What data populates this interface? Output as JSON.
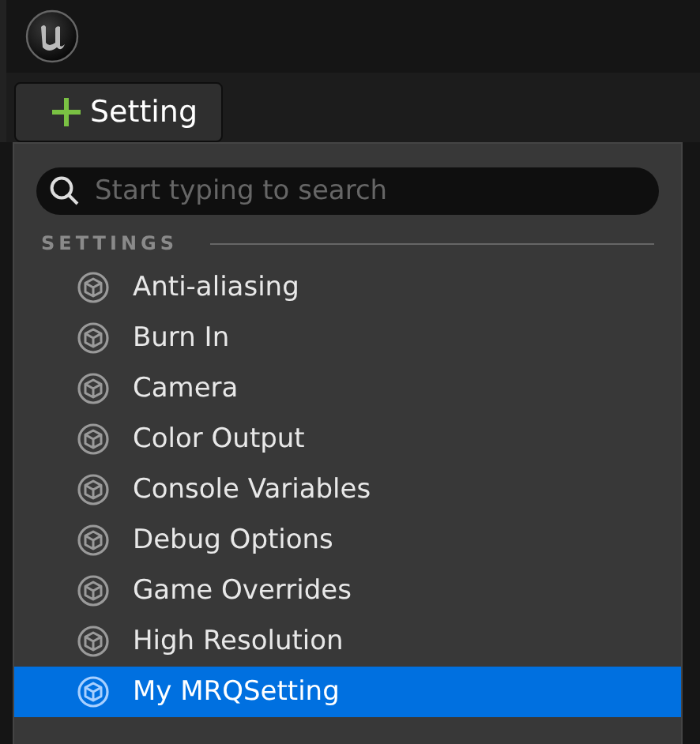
{
  "toolbar": {
    "add_button": {
      "label": "Setting"
    }
  },
  "menu": {
    "search": {
      "placeholder": "Start typing to search"
    },
    "section": "SETTINGS",
    "items": [
      {
        "label": "Anti-aliasing",
        "selected": false
      },
      {
        "label": "Burn In",
        "selected": false
      },
      {
        "label": "Camera",
        "selected": false
      },
      {
        "label": "Color Output",
        "selected": false
      },
      {
        "label": "Console Variables",
        "selected": false
      },
      {
        "label": "Debug Options",
        "selected": false
      },
      {
        "label": "Game Overrides",
        "selected": false
      },
      {
        "label": "High Resolution",
        "selected": false
      },
      {
        "label": "My MRQSetting",
        "selected": true
      }
    ]
  }
}
